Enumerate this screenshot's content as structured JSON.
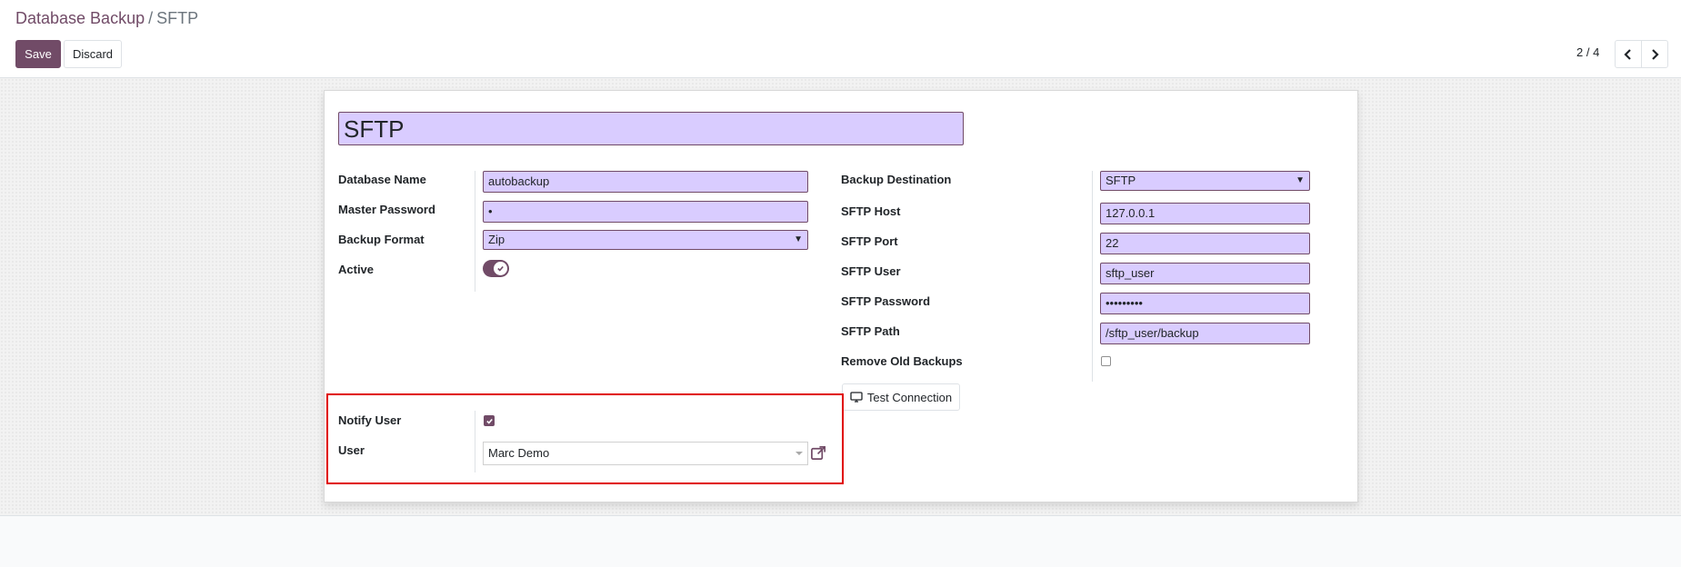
{
  "breadcrumb": {
    "parent": "Database Backup",
    "separator": "/",
    "current": "SFTP"
  },
  "toolbar": {
    "save_label": "Save",
    "discard_label": "Discard"
  },
  "pager": {
    "value": "2 / 4",
    "prev_icon": "chevron-left-icon",
    "next_icon": "chevron-right-icon"
  },
  "record": {
    "name": "SFTP"
  },
  "left_fields": {
    "database_name": {
      "label": "Database Name",
      "value": "autobackup"
    },
    "master_password": {
      "label": "Master Password",
      "value": "•"
    },
    "backup_format": {
      "label": "Backup Format",
      "value": "Zip"
    },
    "active": {
      "label": "Active",
      "checked": true
    }
  },
  "right_fields": {
    "backup_destination": {
      "label": "Backup Destination",
      "value": "SFTP"
    },
    "sftp_host": {
      "label": "SFTP Host",
      "value": "127.0.0.1"
    },
    "sftp_port": {
      "label": "SFTP Port",
      "value": "22"
    },
    "sftp_user": {
      "label": "SFTP User",
      "value": "sftp_user"
    },
    "sftp_password": {
      "label": "SFTP Password",
      "value": "•••••••••"
    },
    "sftp_path": {
      "label": "SFTP Path",
      "value": "/sftp_user/backup"
    },
    "remove_old_backups": {
      "label": "Remove Old Backups",
      "checked": false
    }
  },
  "test_connection": {
    "label": "Test Connection",
    "icon": "monitor-icon"
  },
  "notify": {
    "notify_user": {
      "label": "Notify User",
      "checked": true
    },
    "user": {
      "label": "User",
      "value": "Marc Demo",
      "icon": "external-link-icon"
    }
  },
  "colors": {
    "primary": "#714b67",
    "field_bg": "#d9ccff",
    "highlight": "#e00000"
  }
}
